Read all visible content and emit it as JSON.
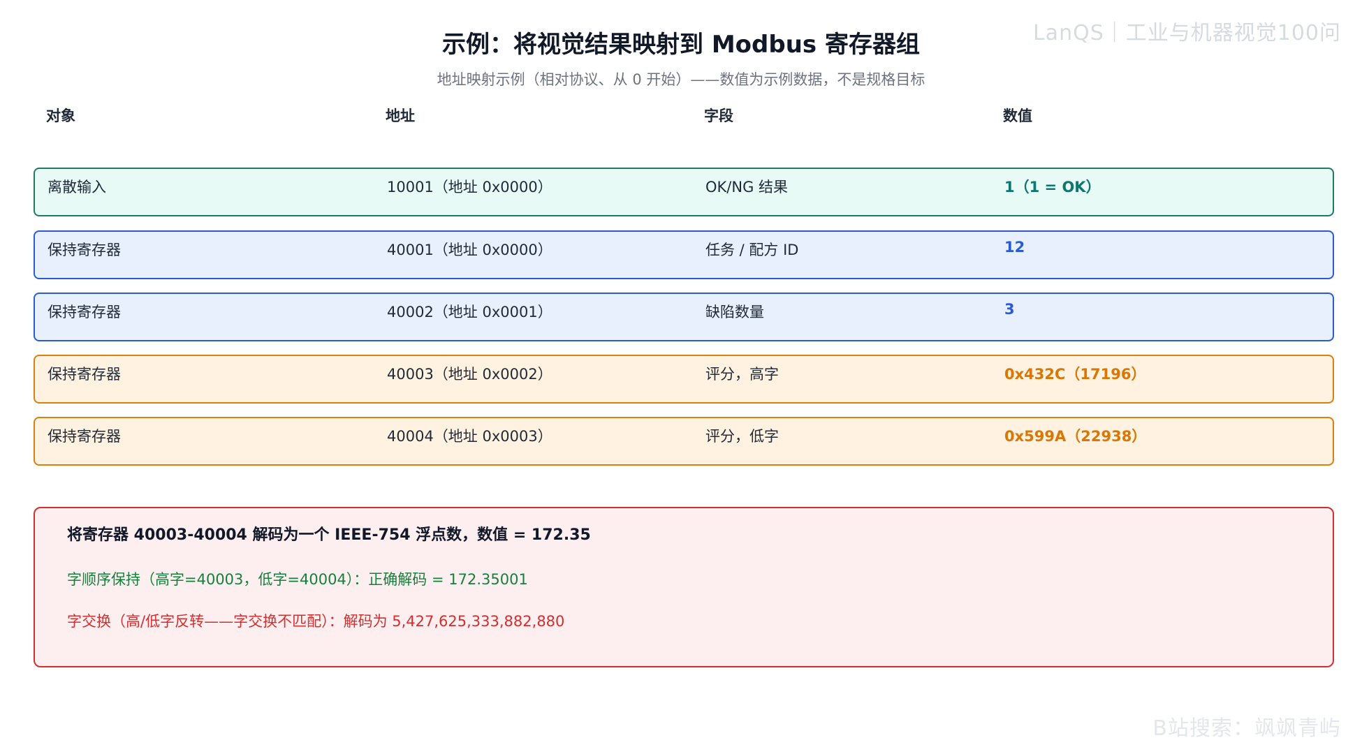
{
  "watermark": "LanQS｜工业与机器视觉100问",
  "watermark_bottom": "B站搜索：飒飒青屿",
  "title": "示例：将视觉结果映射到 Modbus 寄存器组",
  "subtitle": "地址映射示例（相对协议、从 0 开始）——数值为示例数据，不是规格目标",
  "table": {
    "headers": [
      "对象",
      "地址",
      "字段",
      "数值"
    ],
    "rows": [
      {
        "object": "离散输入",
        "address": "10001（地址 0x0000）",
        "field": "OK/NG 结果",
        "value": "1（1 = OK）",
        "color": "#0f766e"
      },
      {
        "object": "保持寄存器",
        "address": "40001（地址 0x0000）",
        "field": "任务 / 配方 ID",
        "value": "12",
        "color": "#2a5bd7"
      },
      {
        "object": "保持寄存器",
        "address": "40002（地址 0x0001）",
        "field": "缺陷数量",
        "value": "3",
        "color": "#2a5bd7"
      },
      {
        "object": "保持寄存器",
        "address": "40003（地址 0x0002）",
        "field": "评分，高字",
        "value": "0x432C（17196）",
        "color": "#d97706"
      },
      {
        "object": "保持寄存器",
        "address": "40004（地址 0x0003）",
        "field": "评分，低字",
        "value": "0x599A（22938）",
        "color": "#d97706"
      }
    ]
  },
  "decode": {
    "title": "将寄存器 40003-40004 解码为一个 IEEE-754 浮点数，数值 = 172.35",
    "correct": "字顺序保持（高字=40003，低字=40004）：正确解码 = 172.35001",
    "swapped": "字交换（高/低字反转——字交换不匹配）：解码为 5,427,625,333,882,880"
  }
}
